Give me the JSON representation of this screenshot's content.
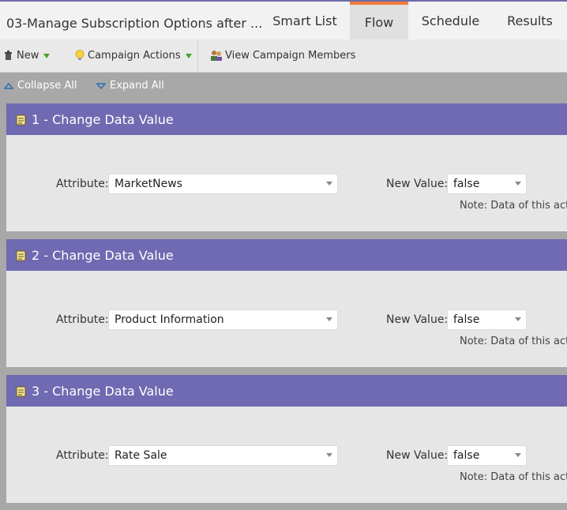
{
  "header": {
    "campaign_title": "03-Manage Subscription Options after ...",
    "tabs": [
      {
        "label": "Smart List",
        "active": false
      },
      {
        "label": "Flow",
        "active": true
      },
      {
        "label": "Schedule",
        "active": false
      },
      {
        "label": "Results",
        "active": false
      }
    ],
    "accent_color": "#f07c3a"
  },
  "toolbar": {
    "new_label": "New",
    "campaign_actions_label": "Campaign Actions",
    "view_members_label": "View Campaign Members"
  },
  "subbar": {
    "collapse_label": "Collapse All",
    "expand_label": "Expand All"
  },
  "steps": [
    {
      "title": "1 - Change Data Value",
      "attribute_label": "Attribute:",
      "attribute_value": "MarketNews",
      "new_value_label": "New Value:",
      "new_value": "false",
      "note": "Note: Data of this activ"
    },
    {
      "title": "2 - Change Data Value",
      "attribute_label": "Attribute:",
      "attribute_value": "Product Information",
      "new_value_label": "New Value:",
      "new_value": "false",
      "note": "Note: Data of this activ"
    },
    {
      "title": "3 - Change Data Value",
      "attribute_label": "Attribute:",
      "attribute_value": "Rate Sale",
      "new_value_label": "New Value:",
      "new_value": "false",
      "note": "Note: Data of this activ"
    }
  ],
  "colors": {
    "step_header": "#6f6ab1",
    "step_body": "#e6e6e6",
    "background": "#a8a8a8"
  },
  "icons": {
    "new": "trash-can-icon",
    "campaign_actions": "lightbulb-icon",
    "view_members": "people-icon",
    "step": "notepad-icon",
    "collapse": "triangle-up-icon",
    "expand": "triangle-down-icon"
  }
}
